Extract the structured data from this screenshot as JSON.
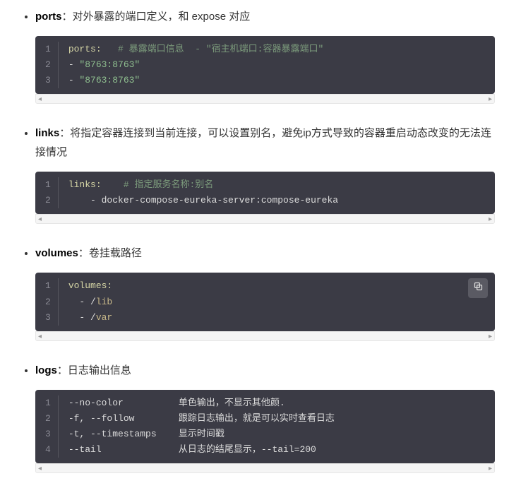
{
  "sections": [
    {
      "term": "ports",
      "desc": "：对外暴露的端口定义，和 expose 对应",
      "code": {
        "lines": [
          [
            {
              "cls": "tok-key",
              "t": "ports:"
            },
            {
              "cls": "tok-plain",
              "t": "   "
            },
            {
              "cls": "tok-comment",
              "t": "# 暴露端口信息  - \"宿主机端口:容器暴露端口\""
            }
          ],
          [
            {
              "cls": "tok-dash",
              "t": "- "
            },
            {
              "cls": "tok-str",
              "t": "\"8763:8763\""
            }
          ],
          [
            {
              "cls": "tok-dash",
              "t": "- "
            },
            {
              "cls": "tok-str",
              "t": "\"8763:8763\""
            }
          ]
        ]
      }
    },
    {
      "term": "links",
      "desc": "：将指定容器连接到当前连接，可以设置别名，避免ip方式导致的容器重启动态改变的无法连接情况",
      "code": {
        "lines": [
          [
            {
              "cls": "tok-key",
              "t": "links:"
            },
            {
              "cls": "tok-plain",
              "t": "    "
            },
            {
              "cls": "tok-comment",
              "t": "# 指定服务名称:别名"
            }
          ],
          [
            {
              "cls": "tok-plain",
              "t": "    - docker-compose-eureka-server:compose-eureka"
            }
          ]
        ]
      }
    },
    {
      "term": "volumes",
      "desc": "：卷挂载路径",
      "show_copy": true,
      "code": {
        "lines": [
          [
            {
              "cls": "tok-key",
              "t": "volumes:"
            }
          ],
          [
            {
              "cls": "tok-plain",
              "t": "  - /"
            },
            {
              "cls": "tok-path",
              "t": "lib"
            }
          ],
          [
            {
              "cls": "tok-plain",
              "t": "  - /"
            },
            {
              "cls": "tok-path",
              "t": "var"
            }
          ]
        ]
      }
    },
    {
      "term": "logs",
      "desc": "：日志输出信息",
      "code": {
        "lines": [
          [
            {
              "cls": "tok-opt",
              "t": "--no-color          单色输出，不显示其他颜."
            }
          ],
          [
            {
              "cls": "tok-opt",
              "t": "-f, --follow        跟踪日志输出，就是可以实时查看日志"
            }
          ],
          [
            {
              "cls": "tok-opt",
              "t": "-t, --timestamps    显示时间戳"
            }
          ],
          [
            {
              "cls": "tok-opt",
              "t": "--tail              从日志的结尾显示，--tail=200"
            }
          ]
        ]
      }
    }
  ],
  "chart_data": {
    "type": "table",
    "title": "docker-compose 配置与命令说明片段",
    "rows": [
      {
        "配置/命令": "ports",
        "说明": "对外暴露的端口定义，和 expose 对应",
        "示例": "- \"8763:8763\""
      },
      {
        "配置/命令": "links",
        "说明": "将指定容器连接到当前连接，可以设置别名，避免ip方式导致的容器重启动态改变的无法连接情况",
        "示例": "- docker-compose-eureka-server:compose-eureka"
      },
      {
        "配置/命令": "volumes",
        "说明": "卷挂载路径",
        "示例": "- /lib  - /var"
      },
      {
        "配置/命令": "logs --no-color",
        "说明": "单色输出，不显示其他颜."
      },
      {
        "配置/命令": "logs -f, --follow",
        "说明": "跟踪日志输出，就是可以实时查看日志"
      },
      {
        "配置/命令": "logs -t, --timestamps",
        "说明": "显示时间戳"
      },
      {
        "配置/命令": "logs --tail",
        "说明": "从日志的结尾显示，--tail=200"
      }
    ]
  }
}
